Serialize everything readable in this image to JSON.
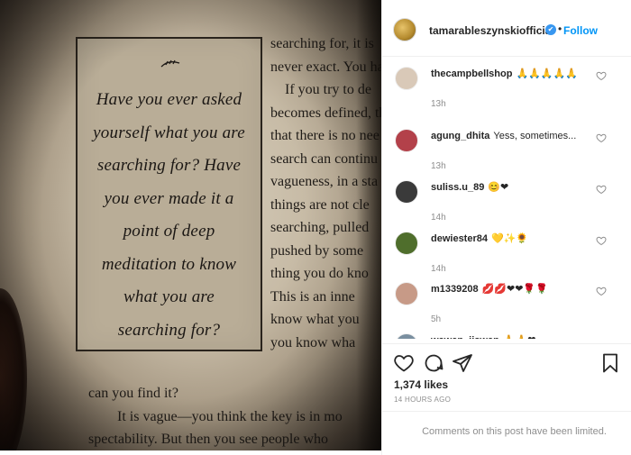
{
  "post": {
    "username": "tamarableszynskiofficial",
    "verified_badge": "✔",
    "separator": "•",
    "follow_label": "Follow",
    "likes": "1,374 likes",
    "time": "14 HOURS AGO",
    "comments_limited": "Comments on this post have been limited."
  },
  "photo": {
    "callout_lines": [
      "Have you ever asked",
      "yourself what you are",
      "searching for? Have",
      "you ever made it a",
      "point of deep",
      "meditation to know",
      "what you are",
      "searching for?"
    ],
    "right_column": [
      "searching for, it is",
      "never exact. You hav",
      "    If you try to de",
      "becomes defined, th",
      "that there is no nee",
      "search can continu",
      "vagueness, in a sta",
      "things are not cle",
      "searching, pulled",
      "pushed by some",
      "thing you do kno",
      "This is an inne",
      "know what you",
      "you know wha"
    ],
    "bottom_lines": [
      "can you find it?",
      "It is vague—you think the key is in mo",
      "spectability. But then you see people who"
    ]
  },
  "comments": [
    {
      "user": "thecampbellshop",
      "text": "🙏🙏🙏🙏🙏",
      "time": "13h",
      "avatar_color": "#d9c9b8"
    },
    {
      "user": "agung_dhita",
      "text": "Yess, sometimes...",
      "time": "13h",
      "avatar_color": "#b3414a"
    },
    {
      "user": "suliss.u_89",
      "text": "😊❤",
      "time": "14h",
      "avatar_color": "#3a3a3a"
    },
    {
      "user": "dewiester84",
      "text": "💛✨🌻",
      "time": "14h",
      "avatar_color": "#4f6e2c"
    },
    {
      "user": "m1339208",
      "text": "💋💋❤❤🌹🌹",
      "time": "5h",
      "avatar_color": "#c79a87"
    },
    {
      "user": "wawan_iiswan",
      "text": "🙏🙏❤",
      "time": "",
      "avatar_color": "#7a8fa0"
    }
  ],
  "icons": {
    "like": "heart-outline-icon",
    "comment": "comment-bubble-icon",
    "share": "paper-plane-icon",
    "save": "bookmark-icon",
    "comment_like": "heart-small-icon"
  },
  "colors": {
    "accent": "#0095f6",
    "muted": "#8e8e8e",
    "text": "#262626"
  }
}
